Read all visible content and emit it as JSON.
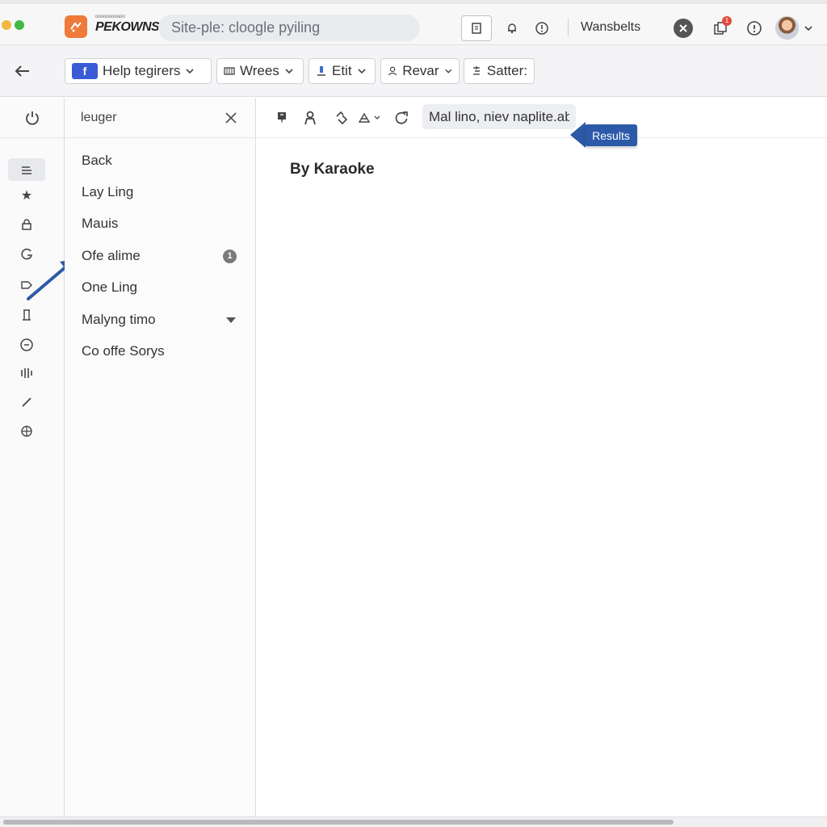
{
  "window": {
    "traffic_lights": [
      "#f4b63e",
      "#42b94a"
    ],
    "brand_small": "ooooooooooo",
    "brand": "PEKOWNS",
    "url_text": "Site-ple: cloogle pyiling",
    "account_label": "Wansbelts",
    "notification_count": "1",
    "accent_colors": {
      "logo": "#ef7a3a",
      "badge": "#e24a3b",
      "tooltip": "#2c5aa8",
      "facebook": "#3b5bd6"
    }
  },
  "filters": {
    "chips": [
      {
        "icon": "f",
        "label": "Help tegirers",
        "has_dropdown": true
      },
      {
        "icon": "list-icon",
        "label": "Wrees",
        "has_dropdown": true
      },
      {
        "icon": "edit-icon",
        "label": "Etit",
        "has_dropdown": true
      },
      {
        "icon": "person-icon",
        "label": "Revar",
        "has_dropdown": true
      },
      {
        "icon": "sort-icon",
        "label": "Satter:",
        "has_dropdown": false
      }
    ]
  },
  "panel": {
    "title": "leuger",
    "items": [
      "Back",
      "Lay Ling",
      "Mauis",
      "Ofe alime",
      "One Ling",
      "Malyng timo",
      "Co offe Sorys"
    ],
    "badge": "1"
  },
  "main": {
    "search_value": "Mal lino, niev naplite.abs",
    "tooltip": "Results",
    "title": "By Karaoke"
  }
}
